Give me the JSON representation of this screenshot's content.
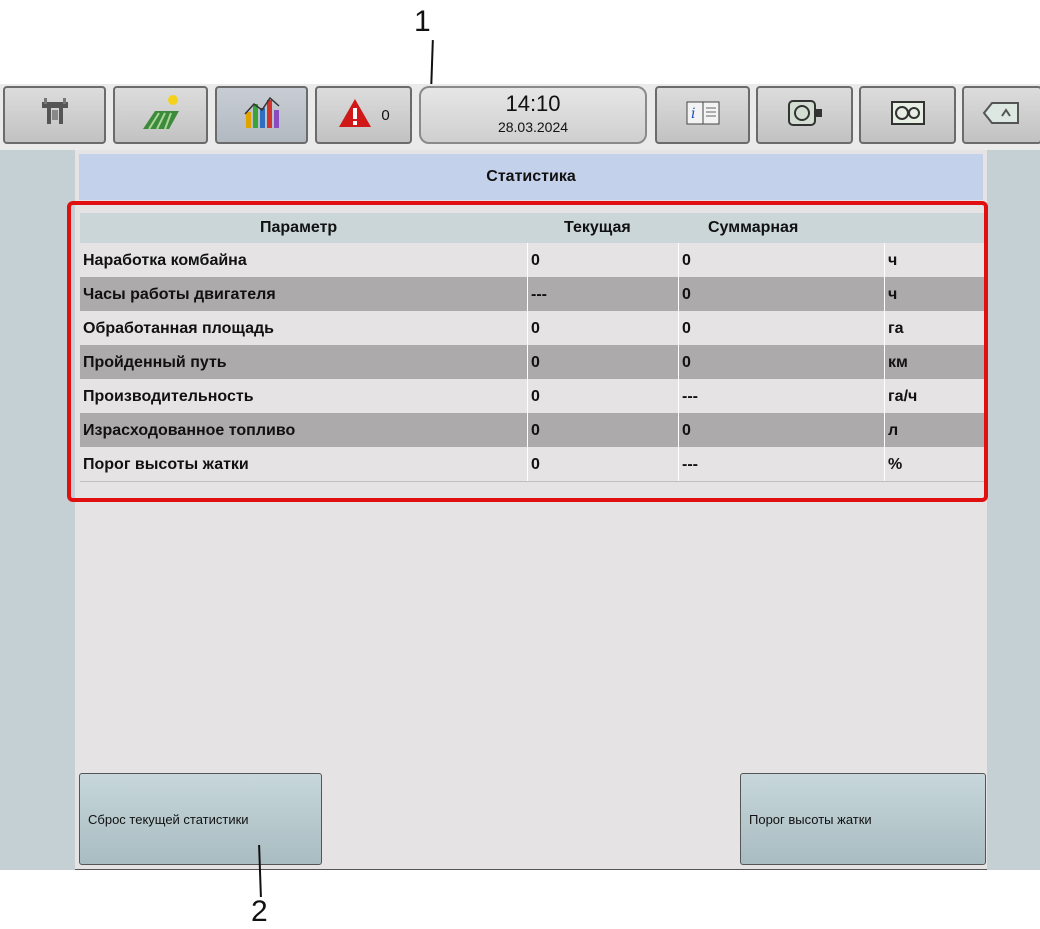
{
  "callouts": [
    "1",
    "2"
  ],
  "toolbar": {
    "buttons": [
      {
        "name": "combine-icon"
      },
      {
        "name": "field-icon"
      },
      {
        "name": "statistics-icon"
      },
      {
        "name": "alarm-icon",
        "count": "0"
      },
      {
        "name": "info-book-icon"
      },
      {
        "name": "engine-icon"
      },
      {
        "name": "gauges-icon"
      },
      {
        "name": "back-arrow-icon"
      }
    ],
    "time": "14:10",
    "date": "28.03.2024"
  },
  "screen_title": "Статистика",
  "table": {
    "headers": [
      "Параметр",
      "Текущая",
      "Суммарная",
      ""
    ],
    "rows": [
      [
        "Наработка комбайна",
        "0",
        "0",
        "ч"
      ],
      [
        "Часы работы двигателя",
        "---",
        "0",
        "ч"
      ],
      [
        "Обработанная площадь",
        "0",
        "0",
        "га"
      ],
      [
        "Пройденный путь",
        "0",
        "0",
        "км"
      ],
      [
        "Производительность",
        "0",
        "---",
        "га/ч"
      ],
      [
        "Израсходованное топливо",
        "0",
        "0",
        "л"
      ],
      [
        "Порог высоты жатки",
        "0",
        "---",
        "%"
      ]
    ]
  },
  "buttons": {
    "reset_stats": "Сброс текущей статистики",
    "header_height_threshold": "Порог высоты жатки"
  },
  "colors": {
    "highlight": "#e01010",
    "title_bar": "#c3d1ea",
    "alt_row": "#acaaaa",
    "alarm": "#d01818"
  }
}
